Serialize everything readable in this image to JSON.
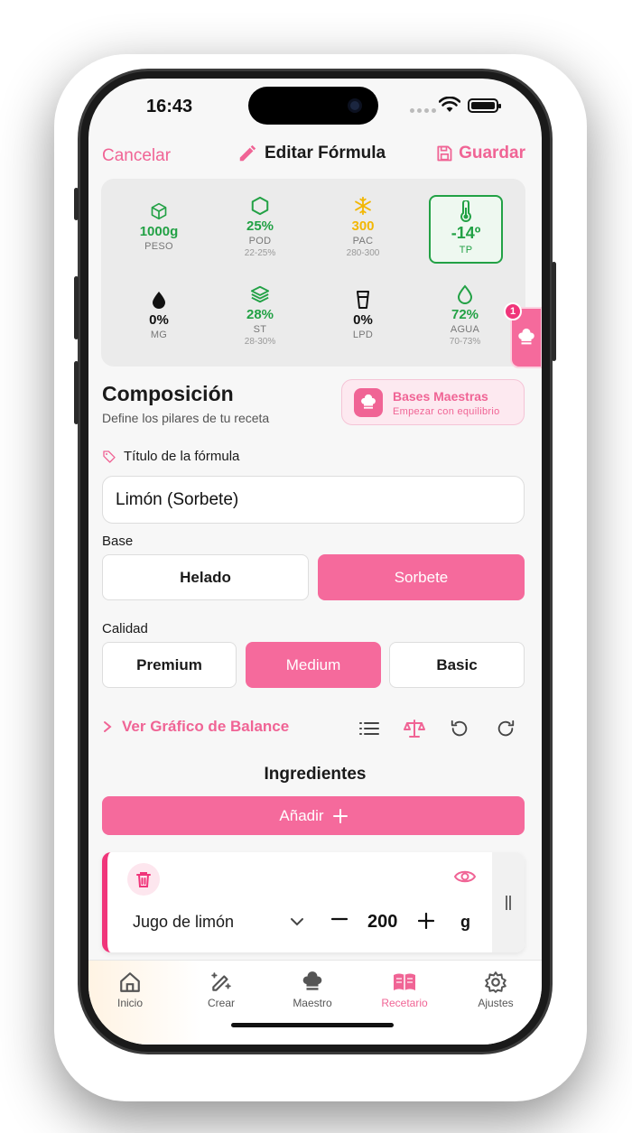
{
  "status": {
    "time": "16:43"
  },
  "nav": {
    "cancel": "Cancelar",
    "title": "Editar Fórmula",
    "save": "Guardar"
  },
  "metrics": [
    {
      "value": "1000g",
      "label": "PESO",
      "range": "",
      "color": "#22a145",
      "icon": "box-icon"
    },
    {
      "value": "25%",
      "label": "POD",
      "range": "22-25%",
      "color": "#22a145",
      "icon": "hexagon-icon"
    },
    {
      "value": "300",
      "label": "PAC",
      "range": "280-300",
      "color": "#f2b705",
      "icon": "snowflake-icon"
    },
    {
      "value": "-14º",
      "label": "TP",
      "range": "",
      "color": "#22a145",
      "icon": "thermometer-icon"
    },
    {
      "value": "0%",
      "label": "MG",
      "range": "",
      "color": "#111111",
      "icon": "drop-icon"
    },
    {
      "value": "28%",
      "label": "ST",
      "range": "28-30%",
      "color": "#22a145",
      "icon": "layers-icon"
    },
    {
      "value": "0%",
      "label": "LPD",
      "range": "",
      "color": "#111111",
      "icon": "glass-icon"
    },
    {
      "value": "72%",
      "label": "AGUA",
      "range": "70-73%",
      "color": "#22a145",
      "icon": "water-drop-icon"
    }
  ],
  "floating": {
    "badge": "1"
  },
  "composition": {
    "title": "Composición",
    "subtitle": "Define los pilares de tu receta",
    "bases_title": "Bases Maestras",
    "bases_subtitle": "Empezar con equilibrio"
  },
  "form": {
    "title_label": "Título de la fórmula",
    "title_value": "Limón (Sorbete)",
    "base_label": "Base",
    "base_options": [
      "Helado",
      "Sorbete"
    ],
    "base_selected": "Sorbete",
    "quality_label": "Calidad",
    "quality_options": [
      "Premium",
      "Medium",
      "Basic"
    ],
    "quality_selected": "Medium"
  },
  "balance": {
    "link": "Ver Gráfico de Balance"
  },
  "ingredients": {
    "title": "Ingredientes",
    "add": "Añadir",
    "items": [
      {
        "name": "Jugo de limón",
        "qty": "200",
        "unit": "g"
      }
    ]
  },
  "tabs": [
    {
      "label": "Inicio",
      "icon": "home-icon"
    },
    {
      "label": "Crear",
      "icon": "magic-pencil-icon"
    },
    {
      "label": "Maestro",
      "icon": "chef-hat-icon"
    },
    {
      "label": "Recetario",
      "icon": "book-icon"
    },
    {
      "label": "Ajustes",
      "icon": "gear-icon"
    }
  ],
  "colors": {
    "accent": "#f06495",
    "good": "#22a145",
    "warn": "#f2b705"
  }
}
